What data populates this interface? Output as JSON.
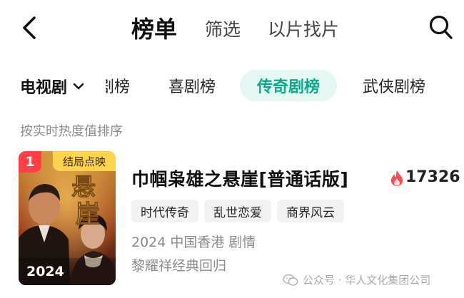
{
  "header": {
    "active_tab": "榜单",
    "filter_tab": "筛选",
    "search_by_film_tab": "以片找片"
  },
  "category": {
    "selected": "电视剧",
    "subtabs": {
      "clipped": "剧榜",
      "comedy": "喜剧榜",
      "legend": "传奇剧榜",
      "wuxia": "武侠剧榜"
    },
    "active_subtab": "传奇剧榜",
    "accent_color": "#10a88a"
  },
  "sort_hint": "按实时热度值排序",
  "item": {
    "rank": "1",
    "badge": "结局点映",
    "poster_year": "2024",
    "poster_title_art": "悬崖",
    "title": "巾帼枭雄之悬崖[普通话版]",
    "heat": "17326",
    "tags": [
      "时代传奇",
      "乱世恋爱",
      "商界风云"
    ],
    "meta": "2024 中国香港 剧情",
    "description": "黎耀祥经典回归"
  },
  "watermark": "公众号 · 华人文化集团公司",
  "icons": {
    "back": "back-arrow-icon",
    "search": "search-icon",
    "dropdown": "chevron-down-icon",
    "heat": "flame-icon",
    "watermark": "wechat-icon"
  },
  "colors": {
    "rank_badge": "#ff3e45",
    "ending_badge": "#ffd34c",
    "heat_flame": "#ff4b4b"
  }
}
